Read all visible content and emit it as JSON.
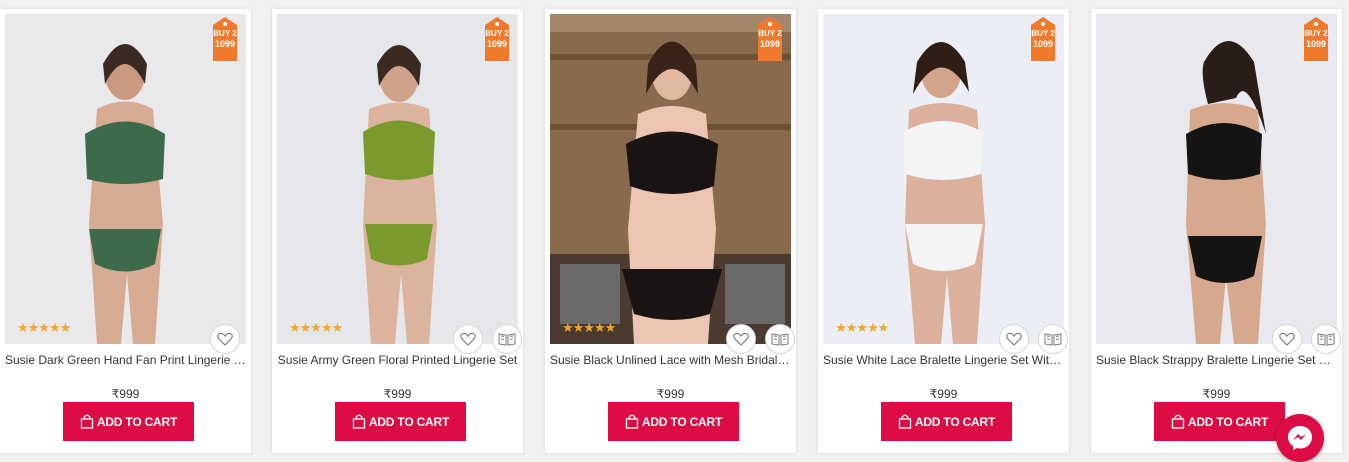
{
  "currency_symbol": "₹",
  "colors": {
    "accent": "#dc0d45",
    "tag": "#f07a2c",
    "stars": "#f5a623"
  },
  "products": [
    {
      "name": "Susie Dark Green Hand Fan Print Lingerie Set",
      "price": "₹999",
      "tag_line1": "BUY 2",
      "tag_line2": "1099",
      "rating": "★★★★★",
      "cart_label": "ADD TO CART",
      "bg": "#e9e9ec",
      "outfit": "#3c6a4a"
    },
    {
      "name": "Susie Army Green Floral Printed Lingerie Set",
      "price": "₹999",
      "tag_line1": "BUY 2",
      "tag_line2": "1099",
      "rating": "★★★★★",
      "cart_label": "ADD TO CART",
      "bg": "#e6e7ea",
      "outfit": "#7a9a2e"
    },
    {
      "name": "Susie Black Unlined Lace with Mesh Bridal Lin...",
      "price": "₹999",
      "tag_line1": "BUY 2",
      "tag_line2": "1099",
      "rating": "★★★★★",
      "cart_label": "ADD TO CART",
      "bg": "#8a6a4c",
      "outfit": "#1a1414"
    },
    {
      "name": "Susie White Lace Bralette Lingerie Set With Tri...",
      "price": "₹999",
      "tag_line1": "BUY 2",
      "tag_line2": "1099",
      "rating": "★★★★★",
      "cart_label": "ADD TO CART",
      "bg": "#ebeef4",
      "outfit": "#f4f4f6"
    },
    {
      "name": "Susie Black Strappy Bralette Lingerie Set With ...",
      "price": "₹999",
      "tag_line1": "BUY 2",
      "tag_line2": "1099",
      "rating": "",
      "cart_label": "ADD TO CART",
      "bg": "#e8e9ee",
      "outfit": "#141414"
    }
  ],
  "icons": {
    "wishlist": "heart-icon",
    "compare": "compare-icon",
    "cart": "shopping-bag-icon",
    "chat": "messenger-icon"
  }
}
